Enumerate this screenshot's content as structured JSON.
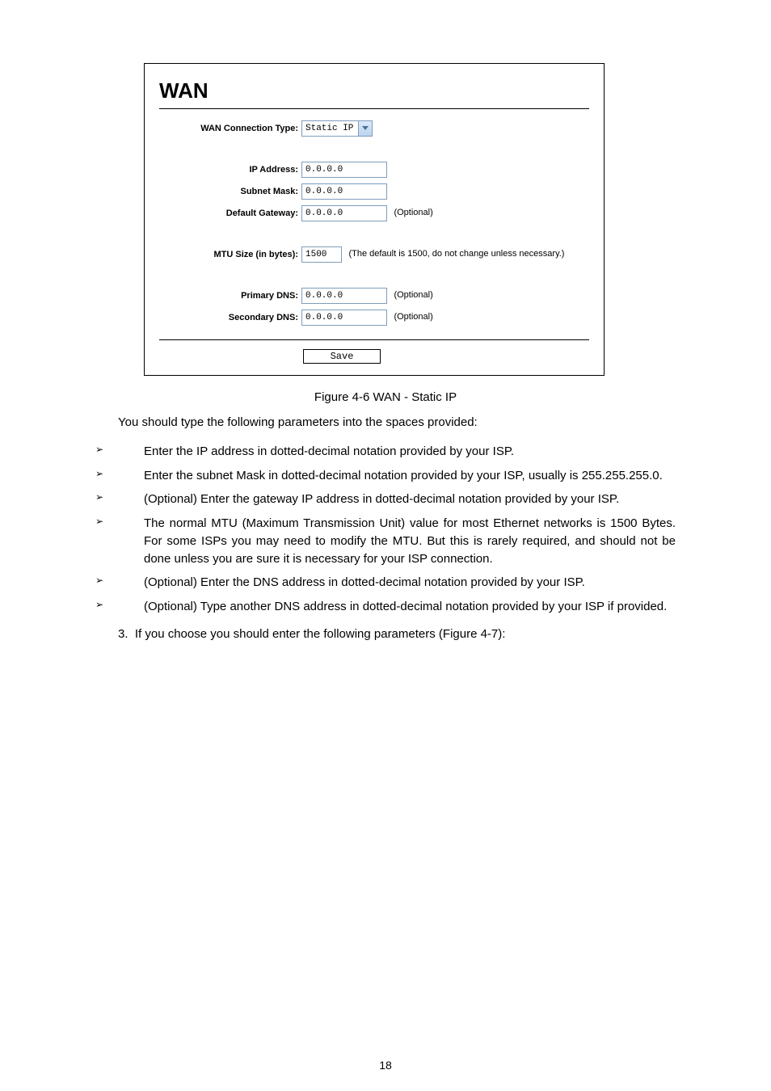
{
  "figure_panel": {
    "title": "WAN",
    "fields": {
      "connection_type": {
        "label": "WAN Connection Type:",
        "value": "Static IP"
      },
      "ip_address": {
        "label": "IP Address:",
        "value": "0.0.0.0"
      },
      "subnet_mask": {
        "label": "Subnet Mask:",
        "value": "0.0.0.0"
      },
      "default_gateway": {
        "label": "Default Gateway:",
        "value": "0.0.0.0",
        "hint": "(Optional)"
      },
      "mtu": {
        "label": "MTU Size (in bytes):",
        "value": "1500",
        "hint": "(The default is 1500, do not change unless necessary.)"
      },
      "primary_dns": {
        "label": "Primary DNS:",
        "value": "0.0.0.0",
        "hint": "(Optional)"
      },
      "secondary_dns": {
        "label": "Secondary DNS:",
        "value": "0.0.0.0",
        "hint": "(Optional)"
      }
    },
    "save_label": "Save"
  },
  "caption": "Figure 4-6 WAN - Static IP",
  "intro": "You should type the following parameters into the spaces provided:",
  "bullets": {
    "b1": "Enter the IP address in dotted-decimal notation provided by your ISP.",
    "b2": "Enter the subnet Mask in dotted-decimal notation provided by your ISP, usually is 255.255.255.0.",
    "b3": "(Optional) Enter the gateway IP address in dotted-decimal notation provided by your ISP.",
    "b4": "The normal MTU (Maximum Transmission Unit) value for most Ethernet networks is 1500 Bytes. For some ISPs you may need to modify the MTU. But this is rarely required, and should not be done unless you are sure it is necessary for your ISP connection.",
    "b5": "(Optional) Enter the DNS address in dotted-decimal notation provided by your ISP.",
    "b6": "(Optional) Type another DNS address in dotted-decimal notation provided by your ISP if provided."
  },
  "numbered": "If you choose            you should enter the following parameters (Figure 4-7):",
  "page_number": "18"
}
